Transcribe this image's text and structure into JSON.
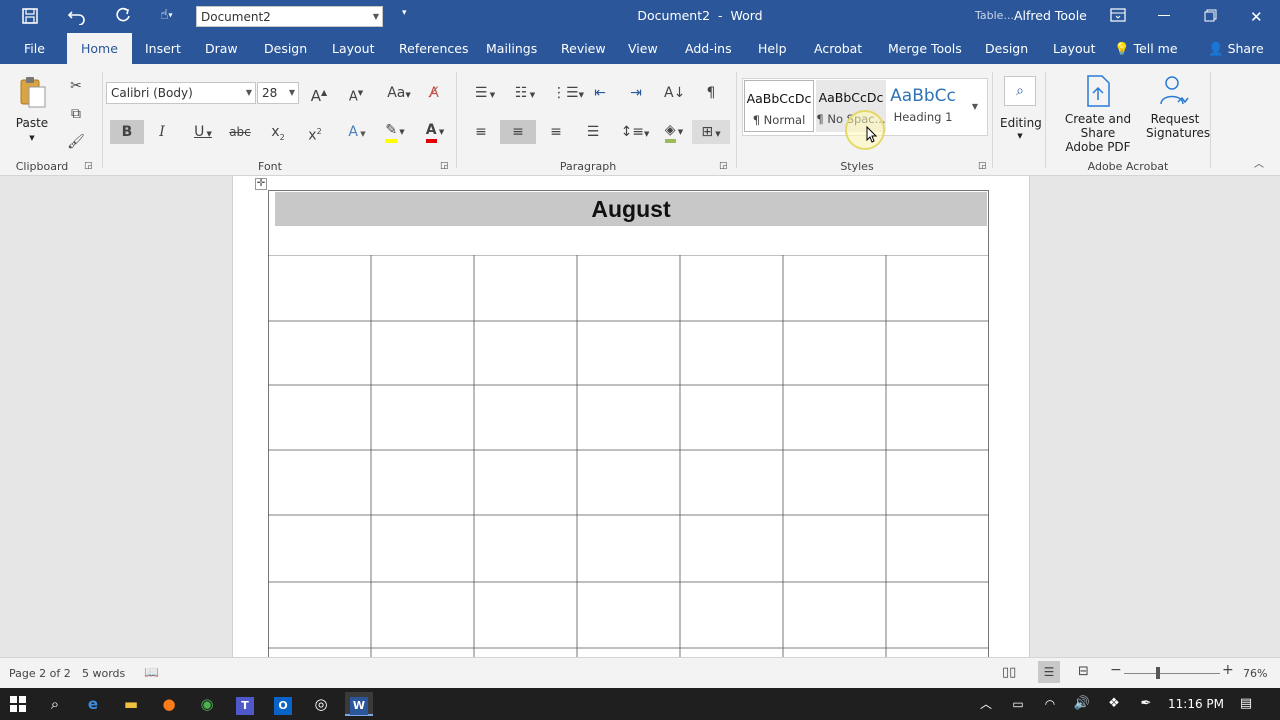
{
  "title_bar": {
    "document_combo": "Document2",
    "window_title": "Document2  -  Word",
    "context_label": "Table...",
    "user_name": "Alfred Toole"
  },
  "tabs": [
    "File",
    "Home",
    "Insert",
    "Draw",
    "Design",
    "Layout",
    "References",
    "Mailings",
    "Review",
    "View",
    "Add-ins",
    "Help",
    "Acrobat",
    "Merge Tools",
    "Design",
    "Layout"
  ],
  "tell_me": "Tell me",
  "share": "Share",
  "ribbon": {
    "clipboard": {
      "paste": "Paste",
      "label": "Clipboard"
    },
    "font": {
      "name": "Calibri (Body)",
      "size": "28",
      "label": "Font"
    },
    "paragraph": {
      "label": "Paragraph"
    },
    "styles": {
      "label": "Styles",
      "items": [
        {
          "sample": "AaBbCcDc",
          "name": "¶ Normal"
        },
        {
          "sample": "AaBbCcDc",
          "name": "¶ No Spac..."
        },
        {
          "sample": "AaBbCc",
          "name": "Heading 1"
        }
      ]
    },
    "editing": {
      "label": "Editing"
    },
    "acrobat": {
      "create_line1": "Create and Share",
      "create_line2": "Adobe PDF",
      "request_line1": "Request",
      "request_line2": "Signatures",
      "label": "Adobe Acrobat"
    }
  },
  "document": {
    "month_title": "August"
  },
  "status": {
    "page": "Page 2 of 2",
    "words": "5 words",
    "zoom": "76%"
  },
  "taskbar": {
    "time": "11:16 PM"
  },
  "colors": {
    "word_blue": "#2b579a",
    "highlight": "#ffff00",
    "font_red": "#e00000"
  }
}
